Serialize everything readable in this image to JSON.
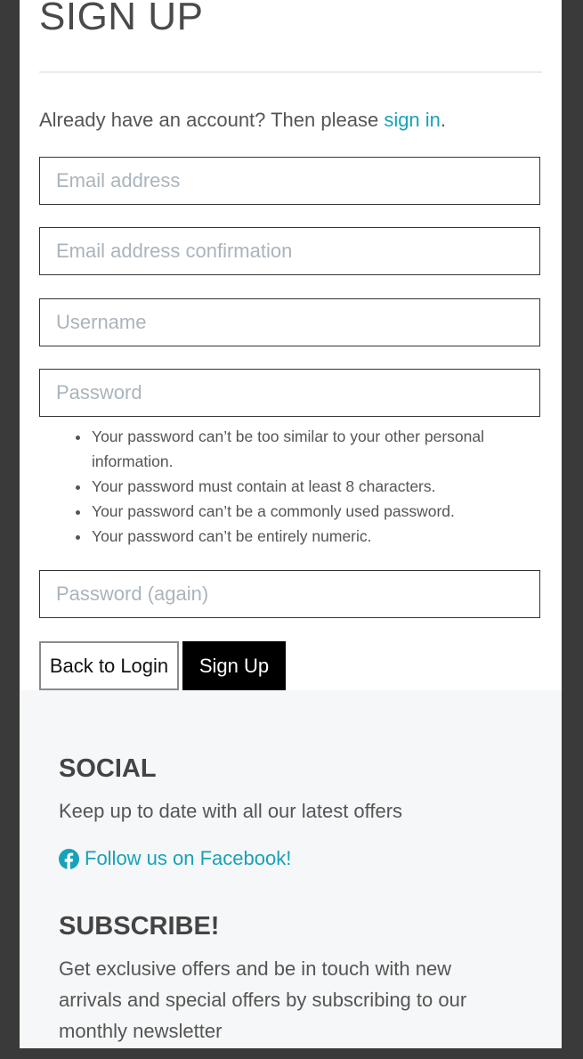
{
  "signup": {
    "title": "SIGN UP",
    "lead_text": "Already have an account? Then please ",
    "signin_link": "sign in",
    "lead_period": ".",
    "fields": {
      "email": "Email address",
      "email_confirm": "Email address confirmation",
      "username": "Username",
      "password": "Password",
      "password_again": "Password (again)"
    },
    "password_hints": [
      "Your password can’t be too similar to your other personal information.",
      "Your password must contain at least 8 characters.",
      "Your password can’t be a commonly used password.",
      "Your password can’t be entirely numeric."
    ],
    "back_button": "Back to Login",
    "submit_button": "Sign Up"
  },
  "footer": {
    "social_heading": "SOCIAL",
    "social_text": "Keep up to date with all our latest offers",
    "facebook_link": "Follow us on Facebook!",
    "facebook_icon": "facebook-icon",
    "subscribe_heading": "SUBSCRIBE!",
    "subscribe_text": "Get exclusive offers and be in touch with new arrivals and special offers by subscribing to our monthly newsletter"
  },
  "colors": {
    "accent": "#17a2b8",
    "page_background": "#3a3a3a",
    "footer_background": "#f6f7f8",
    "primary_button": "#000000"
  }
}
